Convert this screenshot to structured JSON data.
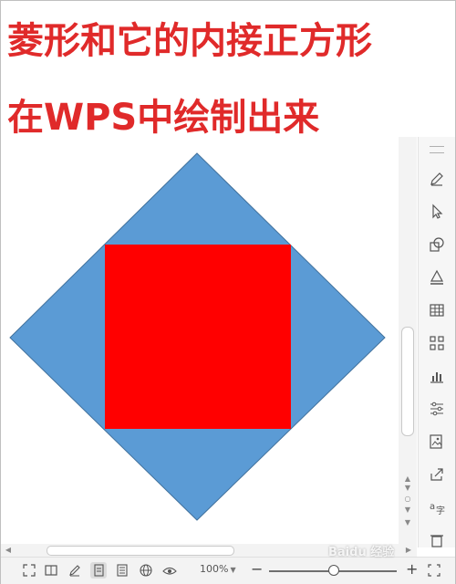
{
  "title": {
    "line1": "菱形和它的内接正方形",
    "line2": "在WPS中绘制出来"
  },
  "colors": {
    "title": "#e02a2a",
    "rhombus_fill": "#5b9bd5",
    "rhombus_stroke": "#41719c",
    "square_fill": "#ff0000"
  },
  "canvas": {
    "shapes": [
      {
        "name": "rhombus",
        "type": "diamond",
        "fill": "#5b9bd5"
      },
      {
        "name": "inscribed-square",
        "type": "square",
        "fill": "#ff0000"
      }
    ]
  },
  "right_toolbar": {
    "buttons": [
      {
        "name": "pen-icon"
      },
      {
        "name": "cursor-icon"
      },
      {
        "name": "shapes-icon"
      },
      {
        "name": "fill-icon"
      },
      {
        "name": "table-icon"
      },
      {
        "name": "grid-icon"
      },
      {
        "name": "chart-icon"
      },
      {
        "name": "adjust-icon"
      },
      {
        "name": "image-icon"
      },
      {
        "name": "share-icon"
      },
      {
        "name": "translate-icon"
      },
      {
        "name": "delete-icon"
      }
    ]
  },
  "statusbar": {
    "icons": [
      {
        "name": "fullscreen-icon"
      },
      {
        "name": "book-view-icon"
      },
      {
        "name": "edit-view-icon"
      },
      {
        "name": "page-view-icon"
      },
      {
        "name": "outline-view-icon"
      },
      {
        "name": "web-view-icon"
      },
      {
        "name": "eye-protect-icon"
      }
    ],
    "zoom_label": "100%",
    "zoom_fraction": 0.5
  },
  "watermark": "Baidu 经验"
}
